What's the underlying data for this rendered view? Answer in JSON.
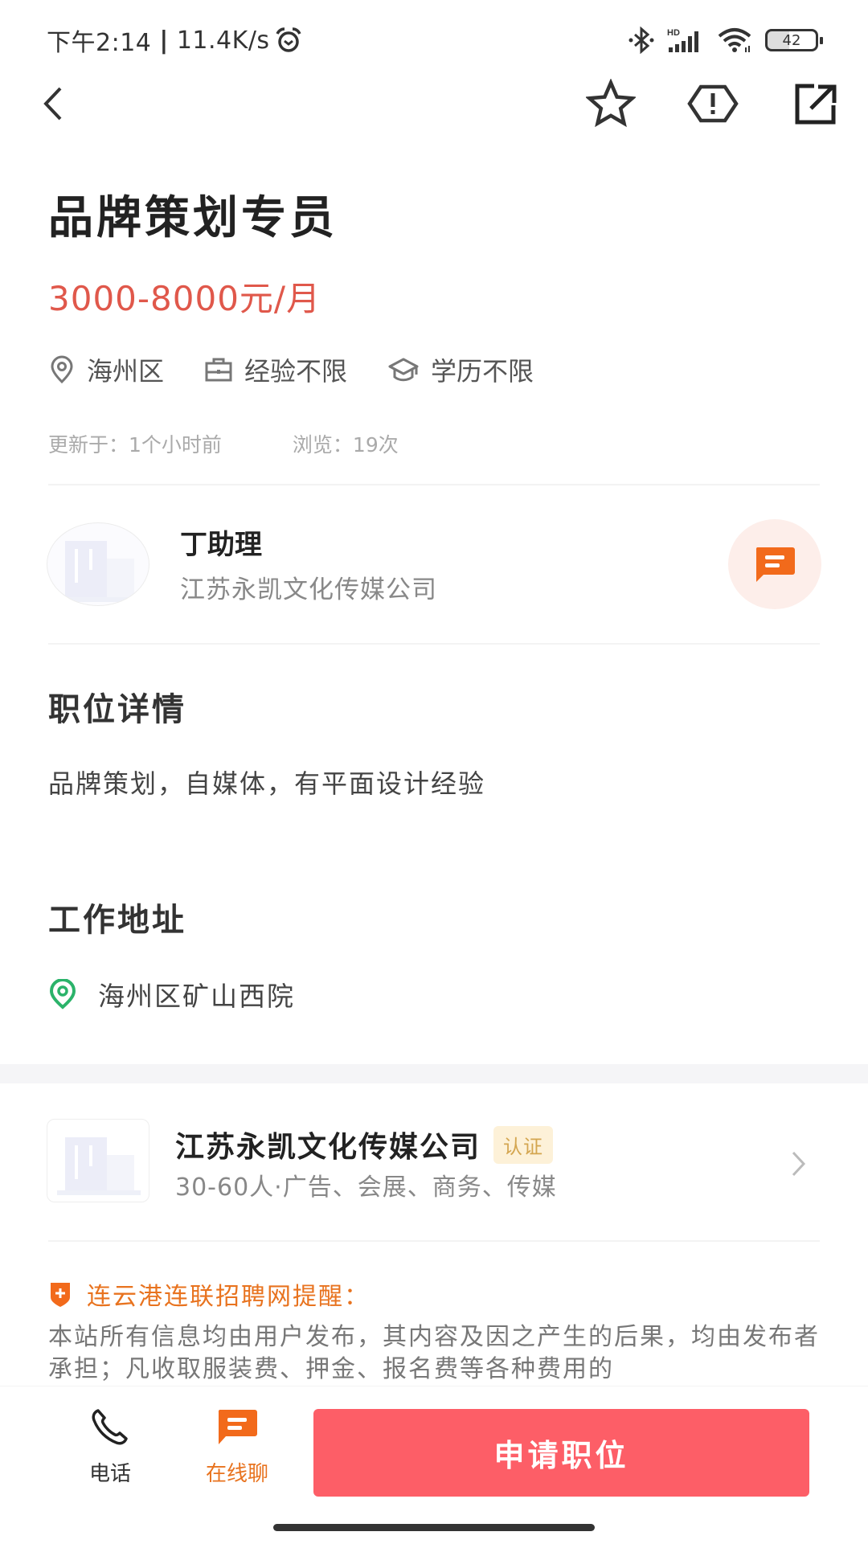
{
  "status_bar": {
    "time": "下午2:14",
    "separator": "|",
    "network_speed": "11.4K/s",
    "battery_level": "42"
  },
  "nav": {
    "back": "back",
    "favorite": "favorite",
    "report": "report",
    "share": "share"
  },
  "job": {
    "title": "品牌策划专员",
    "salary": "3000-8000元/月",
    "tags": [
      {
        "icon": "location-pin-icon",
        "label": "海州区"
      },
      {
        "icon": "briefcase-icon",
        "label": "经验不限"
      },
      {
        "icon": "graduation-cap-icon",
        "label": "学历不限"
      }
    ],
    "updated": "更新于：1个小时前",
    "views": "浏览：19次"
  },
  "recruiter": {
    "name": "丁助理",
    "company": "江苏永凯文化传媒公司"
  },
  "details": {
    "heading": "职位详情",
    "description": "品牌策划，自媒体，有平面设计经验"
  },
  "address": {
    "heading": "工作地址",
    "value": "海州区矿山西院"
  },
  "company_card": {
    "name": "江苏永凯文化传媒公司",
    "badge": "认证",
    "info": "30-60人·广告、会展、商务、传媒"
  },
  "notice": {
    "heading": "连云港连联招聘网提醒：",
    "body": "本站所有信息均由用户发布，其内容及因之产生的后果，均由发布者承担；凡收取服装费、押金、报名费等各种费用的"
  },
  "bottom_bar": {
    "phone_label": "电话",
    "chat_label": "在线聊",
    "apply_label": "申请职位"
  },
  "colors": {
    "salary": "#e0584b",
    "accent_orange": "#f26a1b",
    "apply_button": "#fd5e67",
    "address_pin": "#2bb36a",
    "badge_bg": "#fdf1d8",
    "badge_text": "#d4a650"
  }
}
